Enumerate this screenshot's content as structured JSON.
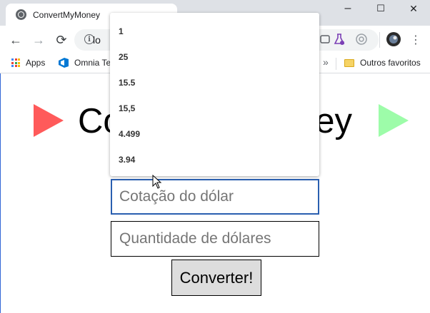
{
  "browser": {
    "tab_title": "ConvertMyMoney",
    "url_visible": "lo",
    "bookmarks": [
      {
        "label": "Apps",
        "icon": "apps-grid-icon"
      },
      {
        "label": "Omnia Te",
        "icon": "azure-devops-icon"
      },
      {
        "label": "Outros favoritos",
        "icon": "folder-icon"
      }
    ],
    "bookmarks_overflow": "»",
    "window_controls": {
      "minimize": "–",
      "maximize": "☐",
      "close": "✕"
    },
    "nav": {
      "back": "←",
      "forward": "→",
      "reload": "⟳"
    },
    "menu_glyph": "⋮"
  },
  "page": {
    "title": "ConvertMyMoney",
    "rate_placeholder": "Cotação do dólar",
    "amount_placeholder": "Quantidade de dólares",
    "convert_label": "Converter!",
    "triangle_left_color": "#ff5a5a",
    "triangle_right_color": "#9dfca9"
  },
  "autocomplete": {
    "options": [
      "1",
      "25",
      "15.5",
      "15,5",
      "4.499",
      "3.94"
    ]
  }
}
